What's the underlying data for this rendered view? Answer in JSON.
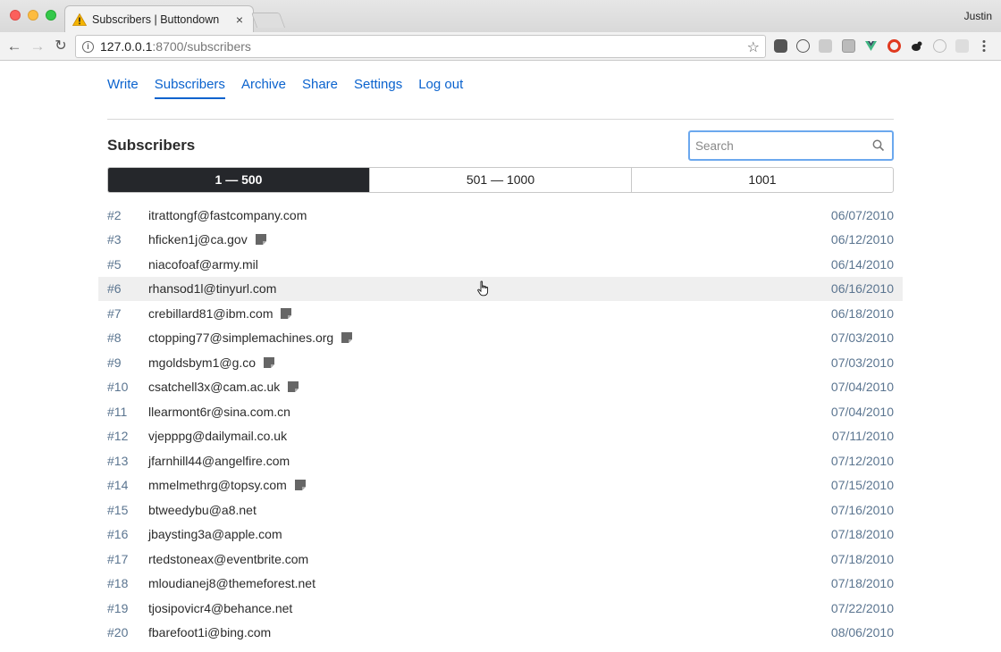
{
  "browser": {
    "tab_title": "Subscribers | Buttondown",
    "tab_close": "×",
    "profile_name": "Justin",
    "url_host": "127.0.0.1",
    "url_path": ":8700/subscribers",
    "back_glyph": "←",
    "forward_glyph": "→",
    "reload_glyph": "↻",
    "star_glyph": "☆"
  },
  "nav": {
    "items": [
      {
        "label": "Write",
        "active": false
      },
      {
        "label": "Subscribers",
        "active": true
      },
      {
        "label": "Archive",
        "active": false
      },
      {
        "label": "Share",
        "active": false
      },
      {
        "label": "Settings",
        "active": false
      },
      {
        "label": "Log out",
        "active": false
      }
    ]
  },
  "page": {
    "title": "Subscribers",
    "search_placeholder": "Search"
  },
  "segments": [
    {
      "label": "1 — 500",
      "active": true
    },
    {
      "label": "501 — 1000",
      "active": false
    },
    {
      "label": "1001",
      "active": false
    }
  ],
  "subscribers": [
    {
      "num": "#2",
      "email": "itrattongf@fastcompany.com",
      "note": false,
      "date": "06/07/2010"
    },
    {
      "num": "#3",
      "email": "hficken1j@ca.gov",
      "note": true,
      "date": "06/12/2010"
    },
    {
      "num": "#5",
      "email": "niacofoaf@army.mil",
      "note": false,
      "date": "06/14/2010"
    },
    {
      "num": "#6",
      "email": "rhansod1l@tinyurl.com",
      "note": false,
      "date": "06/16/2010",
      "hover": true
    },
    {
      "num": "#7",
      "email": "crebillard81@ibm.com",
      "note": true,
      "date": "06/18/2010"
    },
    {
      "num": "#8",
      "email": "ctopping77@simplemachines.org",
      "note": true,
      "date": "07/03/2010"
    },
    {
      "num": "#9",
      "email": "mgoldsbym1@g.co",
      "note": true,
      "date": "07/03/2010"
    },
    {
      "num": "#10",
      "email": "csatchell3x@cam.ac.uk",
      "note": true,
      "date": "07/04/2010"
    },
    {
      "num": "#11",
      "email": "llearmont6r@sina.com.cn",
      "note": false,
      "date": "07/04/2010"
    },
    {
      "num": "#12",
      "email": "vjepppg@dailymail.co.uk",
      "note": false,
      "date": "07/11/2010"
    },
    {
      "num": "#13",
      "email": "jfarnhill44@angelfire.com",
      "note": false,
      "date": "07/12/2010"
    },
    {
      "num": "#14",
      "email": "mmelmethrg@topsy.com",
      "note": true,
      "date": "07/15/2010"
    },
    {
      "num": "#15",
      "email": "btweedybu@a8.net",
      "note": false,
      "date": "07/16/2010"
    },
    {
      "num": "#16",
      "email": "jbaysting3a@apple.com",
      "note": false,
      "date": "07/18/2010"
    },
    {
      "num": "#17",
      "email": "rtedstoneax@eventbrite.com",
      "note": false,
      "date": "07/18/2010"
    },
    {
      "num": "#18",
      "email": "mloudianej8@themeforest.net",
      "note": false,
      "date": "07/18/2010"
    },
    {
      "num": "#19",
      "email": "tjosipovicr4@behance.net",
      "note": false,
      "date": "07/22/2010"
    },
    {
      "num": "#20",
      "email": "fbarefoot1i@bing.com",
      "note": false,
      "date": "08/06/2010"
    }
  ],
  "colors": {
    "link": "#0b63ce",
    "active_segment": "#25272b",
    "muted_text": "#5b7590",
    "hover_row": "#efefef"
  }
}
